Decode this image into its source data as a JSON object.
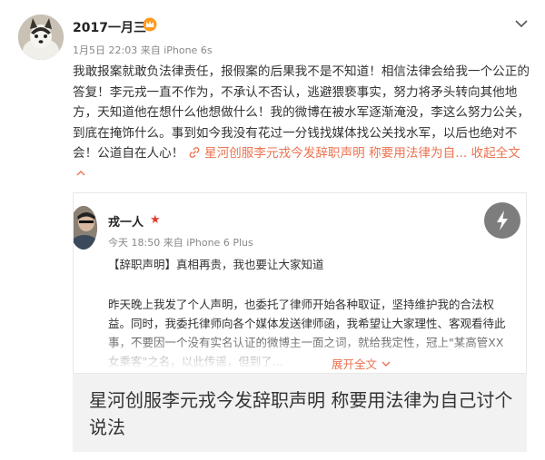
{
  "post": {
    "username": "2017一月三",
    "timestamp": "1月5日 22:03",
    "source": "来自 iPhone 6s",
    "text": "我敢报案就敢负法律责任，报假案的后果我不是不知道！相信法律会给我一个公正的答复！李元戎一直不作为，不承认不否认，逃避猥亵事实，努力将矛头转向其他地方，天知道他在想什么他想做什么！我的微博在被水军逐渐淹没，李这么努力公关，到底在掩饰什么。事到如今我没有花过一分钱找媒体找公关找水军，以后也绝对不会！公道自在人心！",
    "link_text": "星河创服李元戎今发辞职声明 称要用法律为自...",
    "collapse_label": "收起全文",
    "badge_icon": "vip-crown-icon",
    "menu_icon": "chevron-down-icon"
  },
  "card": {
    "author": "戎一人",
    "time": "今天 18:50",
    "source": "来自 iPhone 6 Plus",
    "heading": "【辞职声明】真相再贵，我也要让大家知道",
    "body_lines": [
      "昨天晚上我发了个人声明，也委托了律师开始各种取证，坚持维护我的合法权",
      "益。同时，我委托律师向各个媒体发送律师函，我希望让大家理性、客观看待此",
      "事，不要因一个没有实名认证的微博主一面之词，就给我定性，冠上\"某高管XX",
      "女乘客\"之名，以此传谣，但到了..."
    ],
    "expand_label": "展开全文",
    "caption": "星河创服李元戎今发辞职声明 称要用法律为自己讨个说法"
  },
  "colors": {
    "link": "#eb7350",
    "card_bg": "#f2f2f2",
    "star": "#e23b2e"
  }
}
